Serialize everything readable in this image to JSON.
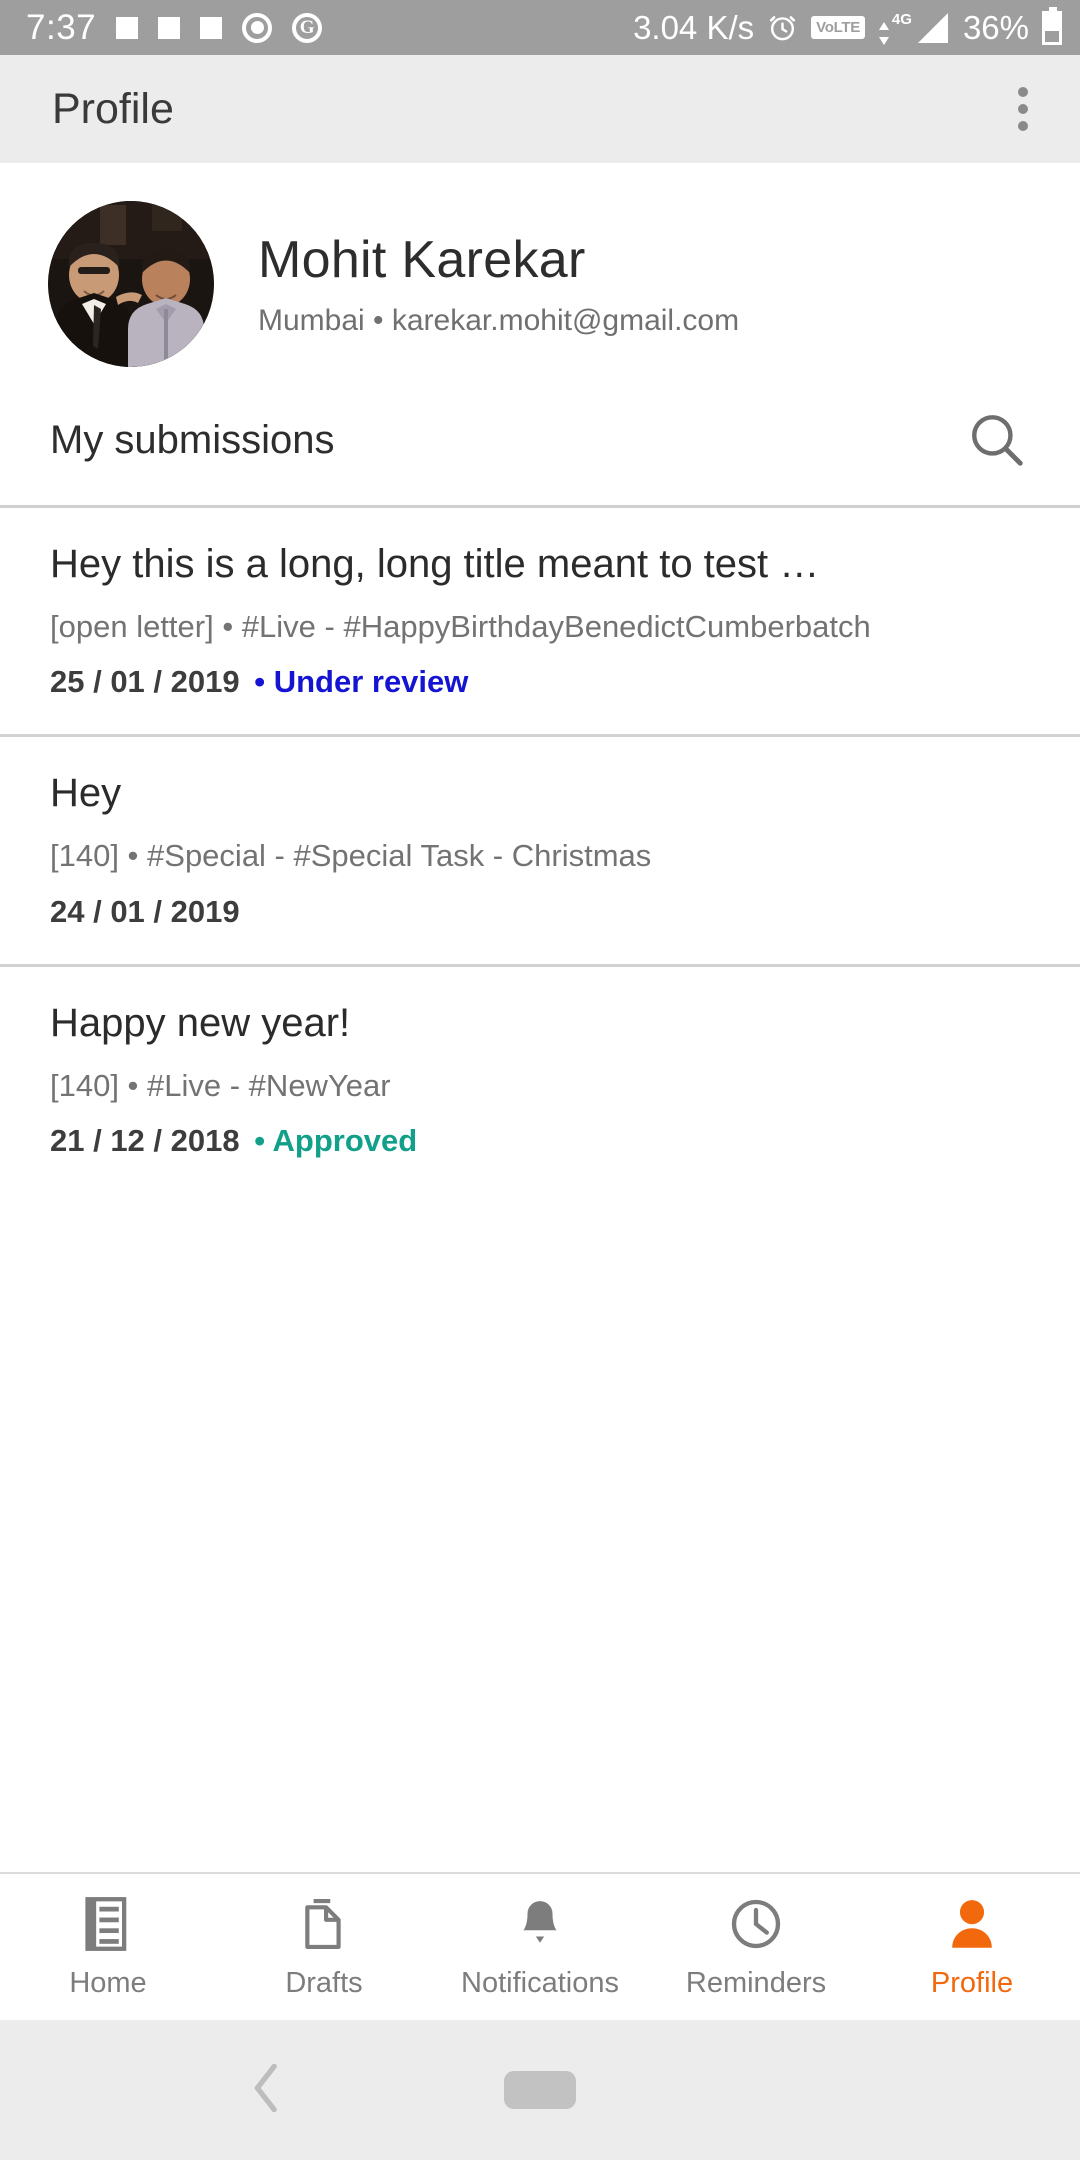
{
  "status_bar": {
    "time": "7:37",
    "network_speed": "3.04 K/s",
    "volte_label": "VoLTE",
    "network_type": "4G",
    "battery_percent": "36%",
    "icons": [
      "notification-square",
      "notification-square",
      "notification-square",
      "circle-record-icon",
      "google-icon",
      "alarm-icon",
      "volte-icon",
      "signal-icon",
      "battery-icon"
    ],
    "background_color": "#9e9e9e"
  },
  "app_bar": {
    "title": "Profile",
    "overflow_label": "More options",
    "background_color": "#ececec"
  },
  "profile": {
    "name": "Mohit Karekar",
    "meta": "Mumbai • karekar.mohit@gmail.com",
    "location": "Mumbai",
    "email": "karekar.mohit@gmail.com",
    "avatar_alt": "Two men in formal attire"
  },
  "submissions_header": {
    "title": "My submissions",
    "search_icon": "search-icon"
  },
  "submissions": [
    {
      "title": "Hey this is a long, long title meant to test …",
      "subtitle": "[open letter] • #Live - #HappyBirthdayBenedictCumberbatch",
      "date": "25 / 01 / 2019",
      "status": "• Under review",
      "status_color": "#1414d2"
    },
    {
      "title": "Hey",
      "subtitle": "[140] • #Special - #Special Task - Christmas",
      "date": "24 / 01 / 2019",
      "status": "",
      "status_color": "#1414d2"
    },
    {
      "title": "Happy new year!",
      "subtitle": "[140] • #Live - #NewYear",
      "date": "21 / 12 / 2018",
      "status": "• Approved",
      "status_color": "#13a08a"
    }
  ],
  "bottom_nav": {
    "active_color": "#f2690d",
    "inactive_color": "#7d7d7d",
    "items": [
      {
        "label": "Home",
        "icon": "home-feed-icon",
        "active": false
      },
      {
        "label": "Drafts",
        "icon": "documents-icon",
        "active": false
      },
      {
        "label": "Notifications",
        "icon": "bell-icon",
        "active": false
      },
      {
        "label": "Reminders",
        "icon": "clock-icon",
        "active": false
      },
      {
        "label": "Profile",
        "icon": "person-icon",
        "active": true
      }
    ]
  },
  "system_nav": {
    "back_icon": "back-chevron-icon",
    "home_icon": "home-pill-icon"
  }
}
